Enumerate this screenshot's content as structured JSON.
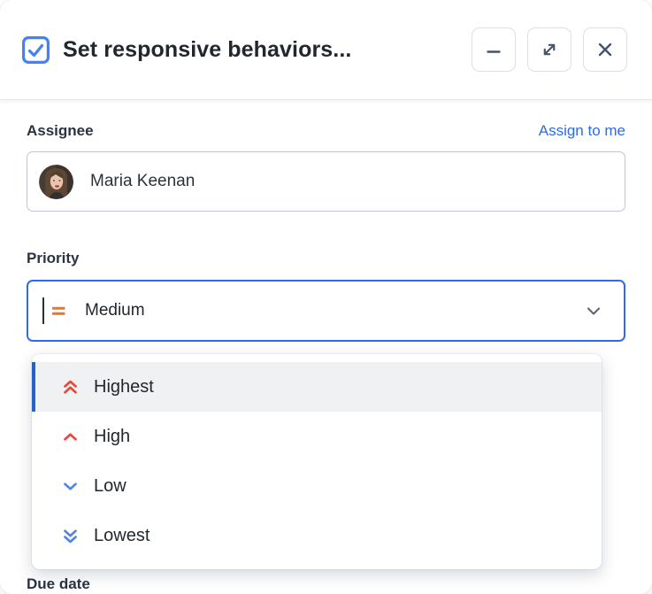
{
  "dialog": {
    "title": "Set responsive behaviors...",
    "type_icon": "task-checkbox-icon",
    "controls": [
      {
        "name": "minimize-button",
        "icon": "minimize-icon"
      },
      {
        "name": "expand-button",
        "icon": "expand-icon"
      },
      {
        "name": "close-button",
        "icon": "close-icon"
      }
    ]
  },
  "assignee": {
    "label": "Assignee",
    "assign_to_me_label": "Assign to me",
    "value": "Maria Keenan",
    "avatar": "maria-keenan-avatar"
  },
  "priority": {
    "label": "Priority",
    "selected": {
      "label": "Medium",
      "icon": "priority-medium-icon",
      "color": "#e9762d"
    },
    "options": [
      {
        "label": "Highest",
        "icon": "priority-highest-icon",
        "color": "#e5493a",
        "highlighted": true
      },
      {
        "label": "High",
        "icon": "priority-high-icon",
        "color": "#e5493a",
        "highlighted": false
      },
      {
        "label": "Low",
        "icon": "priority-low-icon",
        "color": "#5584e2",
        "highlighted": false
      },
      {
        "label": "Lowest",
        "icon": "priority-lowest-icon",
        "color": "#5584e2",
        "highlighted": false
      }
    ]
  },
  "due_date": {
    "label": "Due date"
  },
  "colors": {
    "accent_blue": "#2e6be6",
    "link_blue": "#2e6be6",
    "highlight_bar_blue": "#2563c9",
    "priority_red": "#e5493a",
    "priority_orange": "#e9762d",
    "priority_blue": "#5584e2",
    "title_text": "#22272d",
    "label_text": "#2a3342",
    "border_grey": "#c2c7cf"
  }
}
